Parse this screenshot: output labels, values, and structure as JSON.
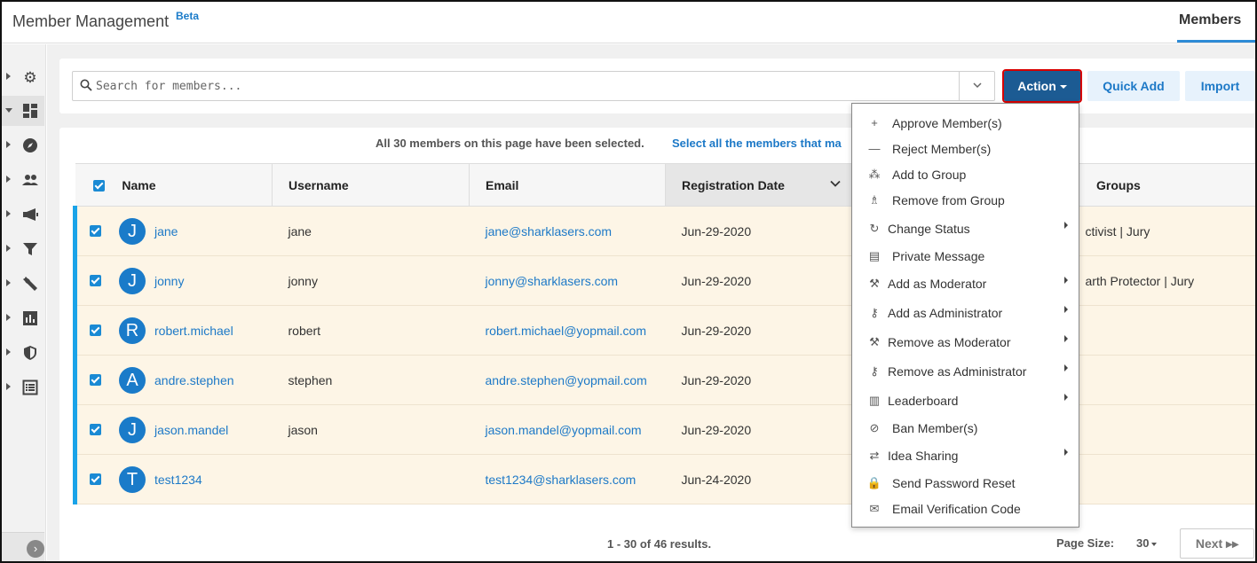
{
  "header": {
    "title": "Member Management",
    "beta": "Beta",
    "tab": "Members"
  },
  "rail": {
    "icons": [
      "gear-icon",
      "dashboard-icon",
      "compass-icon",
      "people-icon",
      "megaphone-icon",
      "filter-icon",
      "wrench-icon",
      "bar-chart-icon",
      "shield-icon",
      "list-icon"
    ],
    "collapse_icon": "chevron-right-icon"
  },
  "search": {
    "placeholder": "Search for members..."
  },
  "toolbar": {
    "action_label": "Action",
    "quick_add_label": "Quick Add",
    "import_label": "Import"
  },
  "selection": {
    "message": "All 30 members on this page have been selected.",
    "link": "Select all the members that ma"
  },
  "table": {
    "columns": [
      "Name",
      "Username",
      "Email",
      "Registration Date",
      "Groups"
    ],
    "rows": [
      {
        "initial": "J",
        "name": "jane",
        "username": "jane",
        "email": "jane@sharklasers.com",
        "date": "Jun-29-2020",
        "groups": "ctivist | Jury"
      },
      {
        "initial": "J",
        "name": "jonny",
        "username": "jonny",
        "email": "jonny@sharklasers.com",
        "date": "Jun-29-2020",
        "groups": "arth Protector | Jury"
      },
      {
        "initial": "R",
        "name": "robert.michael",
        "username": "robert",
        "email": "robert.michael@yopmail.com",
        "date": "Jun-29-2020",
        "groups": ""
      },
      {
        "initial": "A",
        "name": "andre.stephen",
        "username": "stephen",
        "email": "andre.stephen@yopmail.com",
        "date": "Jun-29-2020",
        "groups": ""
      },
      {
        "initial": "J",
        "name": "jason.mandel",
        "username": "jason",
        "email": "jason.mandel@yopmail.com",
        "date": "Jun-29-2020",
        "groups": ""
      },
      {
        "initial": "T",
        "name": "test1234",
        "username": "",
        "email": "test1234@sharklasers.com",
        "date": "Jun-24-2020",
        "groups": ""
      }
    ]
  },
  "pager": {
    "results": "1 - 30 of 46 results.",
    "page_size_label": "Page Size:",
    "page_size": "30",
    "next": "Next ▸▸"
  },
  "menu": {
    "items": [
      {
        "icon": "plus-icon",
        "glyph": "+",
        "label": "Approve Member(s)",
        "submenu": false
      },
      {
        "icon": "minus-icon",
        "glyph": "—",
        "label": "Reject Member(s)",
        "submenu": false
      },
      {
        "icon": "add-group-icon",
        "glyph": "⁂",
        "label": "Add to Group",
        "submenu": false
      },
      {
        "icon": "remove-group-icon",
        "glyph": "♗",
        "label": "Remove from Group",
        "submenu": false
      },
      {
        "icon": "refresh-icon",
        "glyph": "↻",
        "label": "Change Status",
        "submenu": true
      },
      {
        "icon": "message-icon",
        "glyph": "▤",
        "label": "Private Message",
        "submenu": false
      },
      {
        "icon": "gavel-icon",
        "glyph": "⚒",
        "label": "Add as Moderator",
        "submenu": true
      },
      {
        "icon": "key-icon",
        "glyph": "⚷",
        "label": "Add as Administrator",
        "submenu": true
      },
      {
        "icon": "gavel-outline-icon",
        "glyph": "⚒",
        "label": "Remove as Moderator",
        "submenu": true
      },
      {
        "icon": "key-outline-icon",
        "glyph": "⚷",
        "label": "Remove as Administrator",
        "submenu": true
      },
      {
        "icon": "leaderboard-icon",
        "glyph": "▥",
        "label": "Leaderboard",
        "submenu": true
      },
      {
        "icon": "ban-icon",
        "glyph": "⊘",
        "label": "Ban Member(s)",
        "submenu": false
      },
      {
        "icon": "swap-icon",
        "glyph": "⇄",
        "label": "Idea Sharing",
        "submenu": true
      },
      {
        "icon": "lock-icon",
        "glyph": "🔒",
        "label": "Send Password Reset",
        "submenu": false
      },
      {
        "icon": "email-icon",
        "glyph": "✉",
        "label": "Email Verification Code",
        "submenu": false
      }
    ]
  },
  "colors": {
    "accent": "#1c5b93",
    "link": "#1d79c7",
    "row_bg": "#fdf5e6",
    "highlight_border": "#d80000"
  }
}
